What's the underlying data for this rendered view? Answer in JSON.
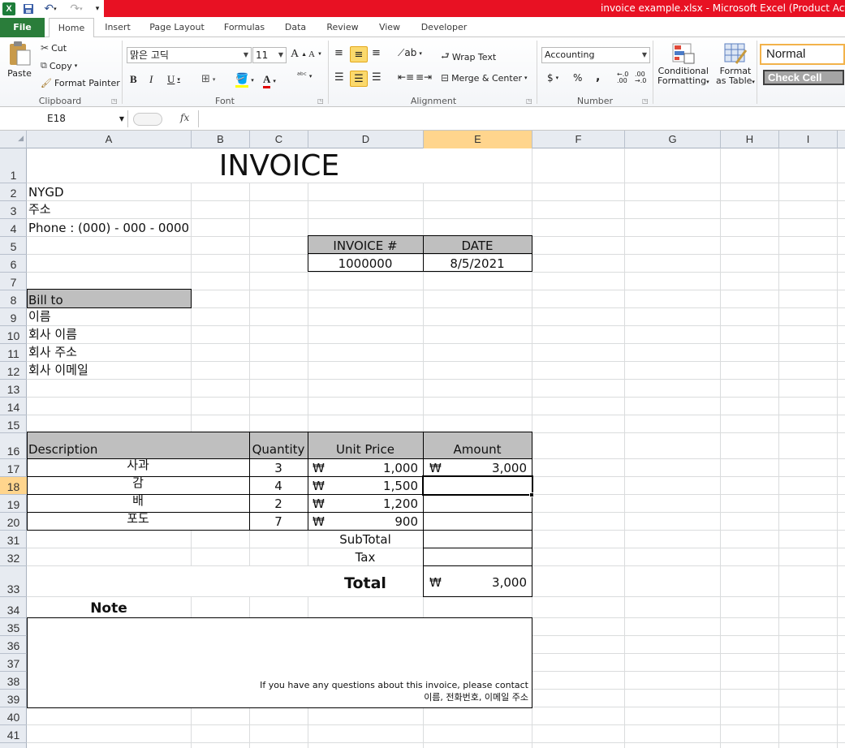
{
  "window": {
    "title": "invoice example.xlsx  -  Microsoft Excel (Product Activatio"
  },
  "ribbon_tabs": [
    "File",
    "Home",
    "Insert",
    "Page Layout",
    "Formulas",
    "Data",
    "Review",
    "View",
    "Developer"
  ],
  "clipboard": {
    "paste": "Paste",
    "cut": "Cut",
    "copy": "Copy",
    "format_painter": "Format Painter",
    "label": "Clipboard"
  },
  "font": {
    "name": "맑은 고딕",
    "size": "11",
    "label": "Font"
  },
  "alignment": {
    "wrap_text": "Wrap Text",
    "merge_center": "Merge & Center",
    "label": "Alignment"
  },
  "number": {
    "format": "Accounting",
    "dollar": "$",
    "percent": "%",
    "comma": ",",
    "label": "Number"
  },
  "styles": {
    "conditional_1": "Conditional",
    "conditional_2": "Formatting",
    "format_1": "Format",
    "format_2": "as Table",
    "normal": "Normal",
    "check_cell": "Check Cell"
  },
  "formula_bar": {
    "name_box": "E18",
    "fx": "fx",
    "value": ""
  },
  "columns": [
    "A",
    "B",
    "C",
    "D",
    "E",
    "F",
    "G",
    "H",
    "I"
  ],
  "rows": [
    "1",
    "2",
    "3",
    "4",
    "5",
    "6",
    "7",
    "8",
    "9",
    "10",
    "11",
    "12",
    "13",
    "14",
    "15",
    "16",
    "17",
    "18",
    "19",
    "20",
    "31",
    "32",
    "33",
    "34",
    "35",
    "36",
    "37",
    "38",
    "39",
    "40",
    "41"
  ],
  "sheet": {
    "title": "INVOICE",
    "company": "NYGD",
    "address": "주소",
    "phone": "Phone : (000) - 000 - 0000",
    "invoice_header": "INVOICE #",
    "date_header": "DATE",
    "invoice_no": "1000000",
    "date": "8/5/2021",
    "bill_to": "Bill to",
    "bill_lines": [
      "이름",
      "회사 이름",
      "회사 주소",
      "회사 이메일"
    ],
    "table_headers": {
      "description": "Description",
      "quantity": "Quantity",
      "unit_price": "Unit Price",
      "amount": "Amount"
    },
    "currency": "₩",
    "items": [
      {
        "description": "사과",
        "quantity": "3",
        "unit_price": "1,000",
        "amount": "3,000"
      },
      {
        "description": "감",
        "quantity": "4",
        "unit_price": "1,500",
        "amount": ""
      },
      {
        "description": "배",
        "quantity": "2",
        "unit_price": "1,200",
        "amount": ""
      },
      {
        "description": "포도",
        "quantity": "7",
        "unit_price": "900",
        "amount": ""
      }
    ],
    "subtotal_label": "SubTotal",
    "tax_label": "Tax",
    "total_label": "Total",
    "total_value": "3,000",
    "note_label": "Note",
    "note_line1": "If you have any questions about this invoice, please contact",
    "note_line2": "이름, 전화번호, 이메일 주소"
  }
}
